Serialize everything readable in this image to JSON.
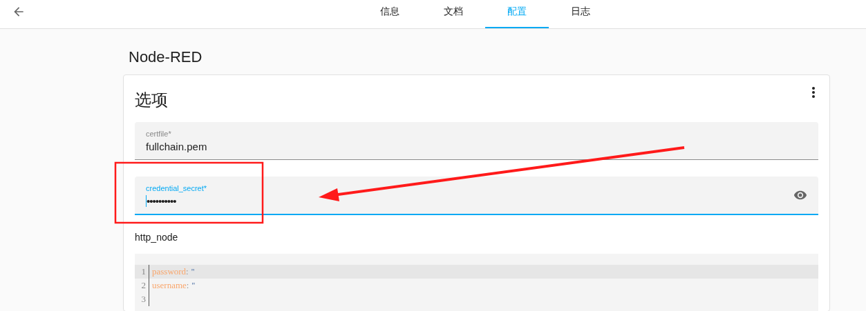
{
  "tabs": [
    {
      "label": "信息",
      "selected": false
    },
    {
      "label": "文档",
      "selected": false
    },
    {
      "label": "配置",
      "selected": true
    },
    {
      "label": "日志",
      "selected": false
    }
  ],
  "addon_title": "Node-RED",
  "card": {
    "title": "选项",
    "fields": [
      {
        "label": "certfile*",
        "value": "fullchain.pem",
        "focused": false,
        "kind": "text"
      },
      {
        "label": "credential_secret*",
        "value": "••••••••••",
        "focused": true,
        "kind": "password"
      }
    ],
    "code_label": "http_node",
    "code_lines": [
      {
        "number": "1",
        "key": "password",
        "sep": ":",
        "value": "''",
        "active": true
      },
      {
        "number": "2",
        "key": "username",
        "sep": ":",
        "value": "''",
        "active": false
      },
      {
        "number": "3",
        "active": false
      }
    ]
  }
}
